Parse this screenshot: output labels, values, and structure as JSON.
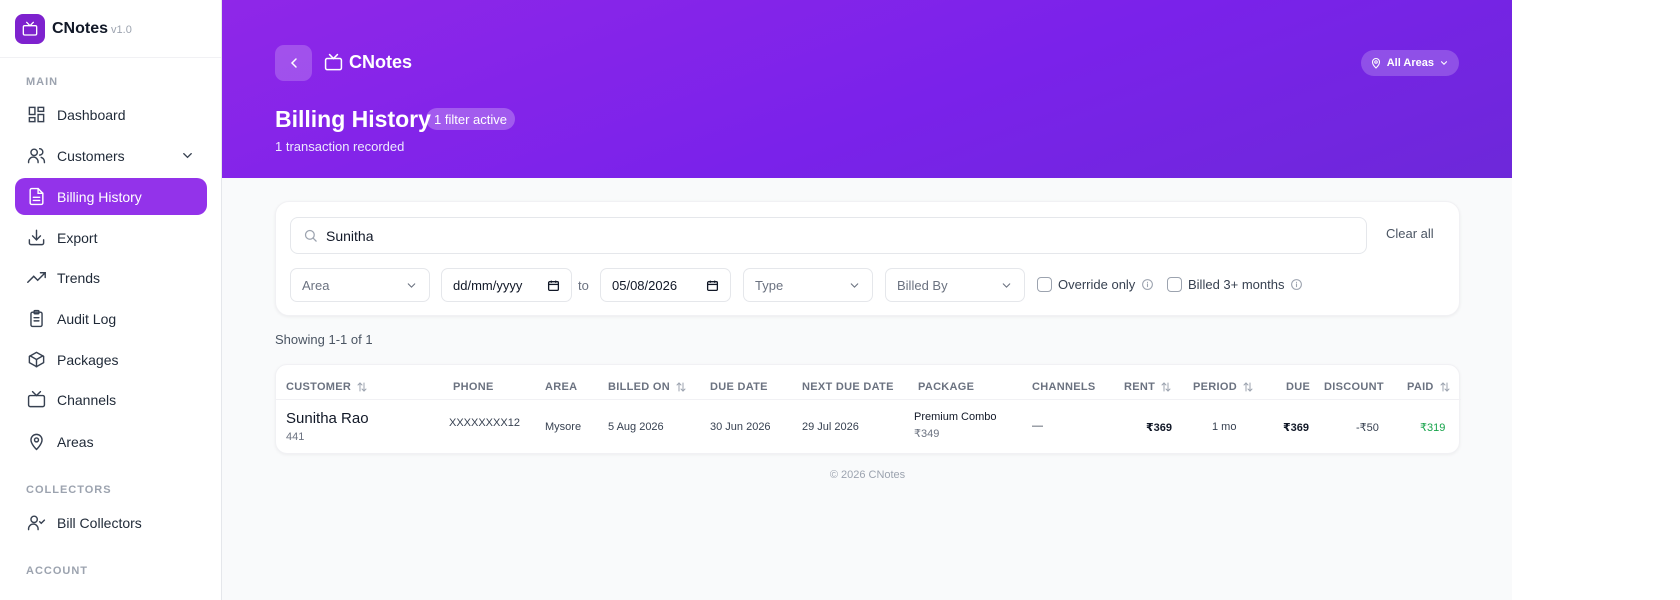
{
  "app": {
    "name": "CNotes",
    "version": "v1.0"
  },
  "sidebar": {
    "sections": [
      {
        "label": "MAIN"
      },
      {
        "label": "COLLECTORS"
      },
      {
        "label": "ACCOUNT"
      }
    ],
    "items": [
      {
        "label": "Dashboard",
        "icon": "dashboard-icon"
      },
      {
        "label": "Customers",
        "icon": "users-icon"
      },
      {
        "label": "Billing History",
        "icon": "file-text-icon",
        "active": true
      },
      {
        "label": "Export",
        "icon": "download-icon"
      },
      {
        "label": "Trends",
        "icon": "trending-up-icon"
      },
      {
        "label": "Audit Log",
        "icon": "clipboard-icon"
      },
      {
        "label": "Packages",
        "icon": "package-icon"
      },
      {
        "label": "Channels",
        "icon": "tv-icon"
      },
      {
        "label": "Areas",
        "icon": "map-pin-icon"
      },
      {
        "label": "Bill Collectors",
        "icon": "user-check-icon"
      }
    ]
  },
  "header": {
    "brand": "CNotes",
    "area_selector": "All Areas",
    "title": "Billing History",
    "filter_badge": "1 filter active",
    "subtitle": "1 transaction recorded"
  },
  "filters": {
    "search_value": "Sunitha",
    "clear_all": "Clear all",
    "area_placeholder": "Area",
    "date_from": "dd/mm/yyyy",
    "to_label": "to",
    "date_to": "05/08/2026",
    "type_placeholder": "Type",
    "billed_by_placeholder": "Billed By",
    "override_only": "Override only",
    "billed_3_months": "Billed 3+ months"
  },
  "results": {
    "showing": "Showing 1-1 of 1"
  },
  "table": {
    "columns": [
      "CUSTOMER",
      "PHONE",
      "AREA",
      "BILLED ON",
      "DUE DATE",
      "NEXT DUE DATE",
      "PACKAGE",
      "CHANNELS",
      "RENT",
      "PERIOD",
      "DUE",
      "DISCOUNT",
      "PAID"
    ],
    "rows": [
      {
        "customer": "Sunitha Rao",
        "customer_id": "441",
        "phone": "XXXXXXXX12",
        "area": "Mysore",
        "billed_on": "5 Aug 2026",
        "due_date": "30 Jun 2026",
        "next_due_date": "29 Jul 2026",
        "package": "Premium Combo",
        "package_price": "₹349",
        "channels": "—",
        "rent": "₹369",
        "period": "1 mo",
        "due": "₹369",
        "discount": "-₹50",
        "paid": "₹319"
      }
    ]
  },
  "footer": "© 2026 CNotes",
  "colors": {
    "accent": "#9333ea",
    "paid": "#16a34a"
  }
}
